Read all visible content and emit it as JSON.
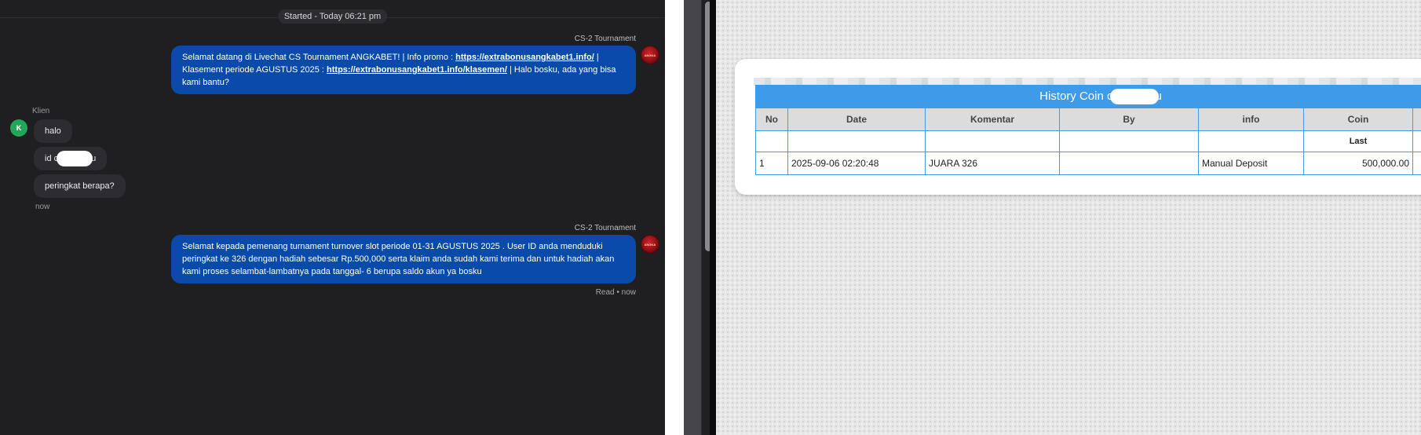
{
  "chat": {
    "started": "Started - Today 06:21 pm",
    "messages": [
      {
        "agent": "CS-2 Tournament",
        "part1": "Selamat datang di Livechat CS Tournament ANGKABET! | Info promo : ",
        "link1": "https://extrabonusangkabet1.info/",
        "part2": " | Klasement periode AGUSTUS 2025 : ",
        "link2": "https://extrabonusangkabet1.info/klasemen/",
        "part3": " | Halo bosku, ada yang bisa kami bantu?"
      },
      {
        "agent": "CS-2 Tournament",
        "text": "Selamat kepada pemenang turnament turnover slot periode 01-31 AGUSTUS 2025 . User ID anda menduduki peringkat ke 326 dengan hadiah sebesar Rp.500,000 serta klaim anda sudah kami terima dan untuk hadiah akan kami proses selambat-lambatnya pada tanggal- 6 berupa saldo akun ya bosku"
      }
    ],
    "avatar_text": "ANGKA",
    "client": {
      "name": "Klien",
      "avatar_initial": "K",
      "msg1": "halo",
      "msg2_prefix": "id c",
      "msg2_suffix": "u",
      "msg3": "peringkat berapa?",
      "time": "now"
    },
    "read_status": "Read • now"
  },
  "history": {
    "title_prefix": "History Coin c",
    "title_suffix": "u",
    "columns": [
      "No",
      "Date",
      "Komentar",
      "By",
      "info",
      "Coin"
    ],
    "sub_header_last": "Last",
    "rows": [
      {
        "no": "1",
        "date": "2025-09-06 02:20:48",
        "komentar": "JUARA 326",
        "by": "",
        "info": "Manual Deposit",
        "coin": "500,000.00"
      }
    ]
  },
  "colors": {
    "chat_bg": "#1f1f22",
    "agent_bubble": "#0a4aa8",
    "client_bubble": "#2d2d31",
    "table_accent": "#3d9be9",
    "coin_green": "#1a8a1a"
  }
}
